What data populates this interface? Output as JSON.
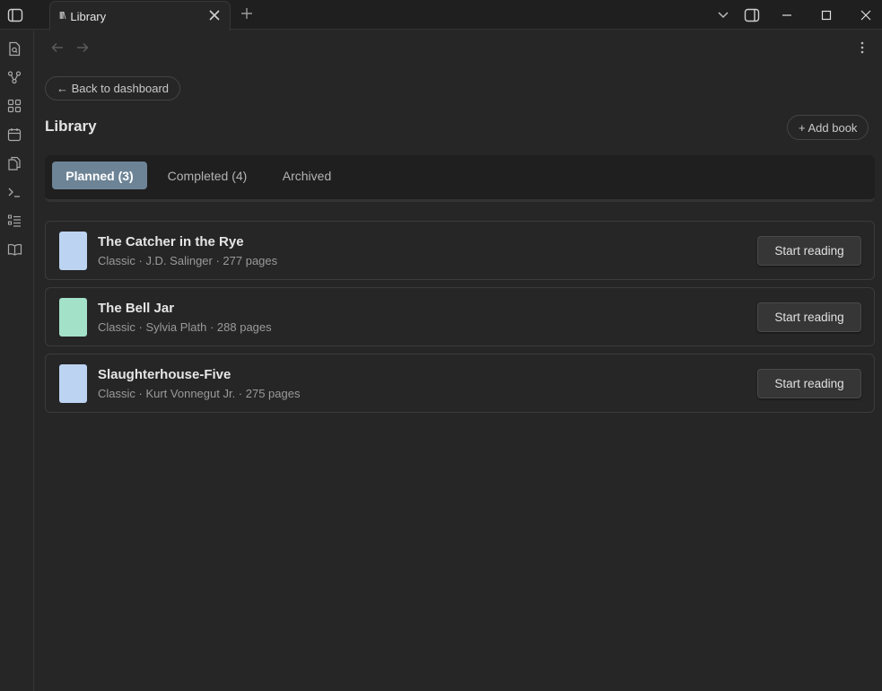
{
  "titlebar": {
    "tab_icon": "lll\\",
    "tab_label": "Library"
  },
  "toolbar": {
    "back_label": "← Back to dashboard",
    "page_title": "Library",
    "add_book_label": "+ Add book"
  },
  "tabs": [
    {
      "label": "Planned (3)",
      "active": true
    },
    {
      "label": "Completed (4)",
      "active": false
    },
    {
      "label": "Archived",
      "active": false
    }
  ],
  "books": [
    {
      "title": "The Catcher in the Rye",
      "meta": "Classic · J.D. Salinger · 277 pages",
      "cover_color": "#bcd4f2",
      "action": "Start reading"
    },
    {
      "title": "The Bell Jar",
      "meta": "Classic · Sylvia Plath · 288 pages",
      "cover_color": "#a4e1c9",
      "action": "Start reading"
    },
    {
      "title": "Slaughterhouse-Five",
      "meta": "Classic · Kurt Vonnegut Jr. · 275 pages",
      "cover_color": "#bcd4f2",
      "action": "Start reading"
    }
  ],
  "ribbon_icons": [
    "search-file-icon",
    "graph-icon",
    "grid-icon",
    "calendar-icon",
    "pages-icon",
    "terminal-icon",
    "list-icon",
    "book-icon"
  ]
}
